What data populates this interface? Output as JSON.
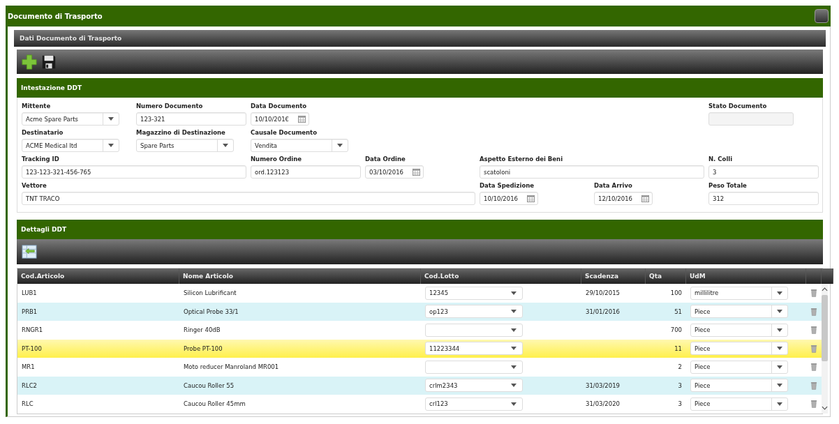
{
  "window": {
    "title": "Documento di Trasporto"
  },
  "panel": {
    "title": "Dati Documento di Trasporto"
  },
  "header_section": {
    "title": "Intestazione DDT",
    "fields": [
      {
        "label": "Mittente",
        "value": "Acme Spare Parts",
        "kind": "select"
      },
      {
        "label": "Numero Documento",
        "value": "123-321",
        "kind": "text"
      },
      {
        "label": "Data Documento",
        "value": "10/10/201€",
        "kind": "date"
      },
      {
        "label": "Stato Documento",
        "kind": "readonly"
      },
      {
        "label": "Destinatario",
        "value": "ACME Medical ltd",
        "kind": "select"
      },
      {
        "label": "Magazzino di Destinazione",
        "value": "Spare Parts",
        "kind": "select"
      },
      {
        "label": "Causale Documento",
        "value": "Vendita",
        "kind": "select"
      },
      {
        "label": "Tracking ID",
        "value": "123-123-321-456-765",
        "kind": "text"
      },
      {
        "label": "Numero Ordine",
        "value": "ord.123123",
        "kind": "text"
      },
      {
        "label": "Data Ordine",
        "value": "03/10/2016",
        "kind": "date"
      },
      {
        "label": "Aspetto Esterno dei Beni",
        "value": "scatoloni",
        "kind": "text"
      },
      {
        "label": "N. Colli",
        "value": "3",
        "kind": "text"
      },
      {
        "label": "Vettore",
        "value": "TNT TRACO",
        "kind": "text"
      },
      {
        "label": "Data Spedizione",
        "value": "10/10/2016",
        "kind": "date"
      },
      {
        "label": "Data Arrivo",
        "value": "12/10/2016",
        "kind": "date"
      },
      {
        "label": "Peso Totale",
        "value": "312",
        "kind": "text"
      }
    ]
  },
  "details_section": {
    "title": "Dettagli DDT",
    "table": {
      "columns": [
        "Cod.Articolo",
        "Nome Articolo",
        "Cod.Lotto",
        "Scadenza",
        "Qta",
        "UdM"
      ],
      "rows": [
        {
          "code": "LUB1",
          "name": "Silicon Lubrificant",
          "lot": "12345",
          "expiry": "29/10/2015",
          "qty": "100",
          "unit": "millilitre",
          "selected": false
        },
        {
          "code": "PRB1",
          "name": "Optical Probe 33/1",
          "lot": "op123",
          "expiry": "31/01/2016",
          "qty": "51",
          "unit": "Piece",
          "selected": false
        },
        {
          "code": "RNGR1",
          "name": "Ringer 40dB",
          "qty": "700",
          "unit": "Piece",
          "selected": false
        },
        {
          "code": "PT-100",
          "name": "Probe PT-100",
          "lot": "11223344",
          "qty": "11",
          "unit": "Piece",
          "selected": true
        },
        {
          "code": "MR1",
          "name": "Moto reducer Manroland MR001",
          "qty": "2",
          "unit": "Piece",
          "selected": false
        },
        {
          "code": "RLC2",
          "name": "Caucou Roller 55",
          "lot": "crlm2343",
          "expiry": "31/03/2019",
          "qty": "3",
          "unit": "Piece",
          "selected": false
        },
        {
          "code": "RLC",
          "name": "Caucou Roller 45mm",
          "lot": "crl123",
          "expiry": "31/03/2020",
          "qty": "3",
          "unit": "Piece",
          "selected": false
        }
      ]
    }
  }
}
